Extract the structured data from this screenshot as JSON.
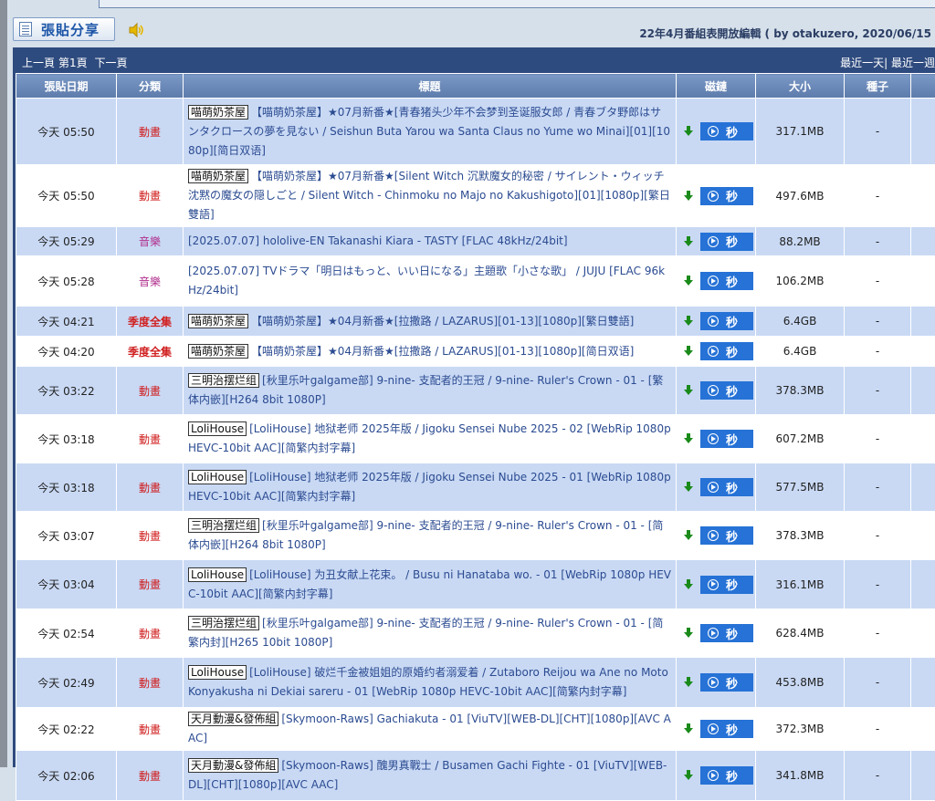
{
  "toolbar": {
    "post_label": "張貼分享"
  },
  "notice": {
    "text": "22年4月番組表開放編輯 ( by otakuzero, 2020/06/15"
  },
  "nav": {
    "prev": "上一頁",
    "page": "第1頁",
    "next": "下一頁",
    "recent_day": "最近一天",
    "sep": "|",
    "recent_more": "最近一週"
  },
  "columns": [
    "張貼日期",
    "分類",
    "標題",
    "磁鏈",
    "大小",
    "種子"
  ],
  "magnet_label": "秒",
  "rows": [
    {
      "date": "今天 05:50",
      "cat": "動畫",
      "cat_type": "anime",
      "tag": "喵萌奶茶屋",
      "title": "【喵萌奶茶屋】★07月新番★[青春猪头少年不会梦到圣诞服女郎 / 青春ブタ野郎はサンタクロースの夢を見ない / Seishun Buta Yarou wa Santa Claus no Yume wo Minai][01][1080p][简日双语]",
      "size": "317.1MB",
      "seed": "-"
    },
    {
      "date": "今天 05:50",
      "cat": "動畫",
      "cat_type": "anime",
      "tag": "喵萌奶茶屋",
      "title": "【喵萌奶茶屋】★07月新番★[Silent Witch 沉默魔女的秘密 / サイレント・ウィッチ 沈黙の魔女の隠しごと / Silent Witch - Chinmoku no Majo no Kakushigoto][01][1080p][繁日雙語]",
      "size": "497.6MB",
      "seed": "-"
    },
    {
      "date": "今天 05:29",
      "cat": "音樂",
      "cat_type": "music",
      "tag": "",
      "title": "[2025.07.07] hololive-EN Takanashi Kiara - TASTY [FLAC 48kHz/24bit]",
      "size": "88.2MB",
      "seed": "-"
    },
    {
      "date": "今天 05:28",
      "cat": "音樂",
      "cat_type": "music",
      "tag": "",
      "title": "[2025.07.07] TVドラマ「明日はもっと、いい日になる」主題歌「小さな歌」 / JUJU [FLAC 96kHz/24bit]",
      "size": "106.2MB",
      "seed": "-"
    },
    {
      "date": "今天 04:21",
      "cat": "季度全集",
      "cat_type": "season",
      "tag": "喵萌奶茶屋",
      "title": "【喵萌奶茶屋】★04月新番★[拉撒路 / LAZARUS][01-13][1080p][繁日雙語]",
      "size": "6.4GB",
      "seed": "-"
    },
    {
      "date": "今天 04:20",
      "cat": "季度全集",
      "cat_type": "season",
      "tag": "喵萌奶茶屋",
      "title": "【喵萌奶茶屋】★04月新番★[拉撒路 / LAZARUS][01-13][1080p][简日双语]",
      "size": "6.4GB",
      "seed": "-"
    },
    {
      "date": "今天 03:22",
      "cat": "動畫",
      "cat_type": "anime",
      "tag": "三明治摆烂组",
      "title": "[秋里乐叶galgame部] 9-nine- 支配者的王冠 / 9-nine- Ruler's Crown - 01 - [繁体内嵌][H264 8bit 1080P]",
      "size": "378.3MB",
      "seed": "-"
    },
    {
      "date": "今天 03:18",
      "cat": "動畫",
      "cat_type": "anime",
      "tag": "LoliHouse",
      "title": "[LoliHouse] 地狱老师 2025年版 / Jigoku Sensei Nube 2025 - 02 [WebRip 1080p HEVC-10bit AAC][简繁内封字幕]",
      "size": "607.2MB",
      "seed": "-"
    },
    {
      "date": "今天 03:18",
      "cat": "動畫",
      "cat_type": "anime",
      "tag": "LoliHouse",
      "title": "[LoliHouse] 地狱老师 2025年版 / Jigoku Sensei Nube 2025 - 01 [WebRip 1080p HEVC-10bit AAC][简繁内封字幕]",
      "size": "577.5MB",
      "seed": "-"
    },
    {
      "date": "今天 03:07",
      "cat": "動畫",
      "cat_type": "anime",
      "tag": "三明治摆烂组",
      "title": "[秋里乐叶galgame部] 9-nine- 支配者的王冠 / 9-nine- Ruler's Crown - 01 - [简体内嵌][H264 8bit 1080P]",
      "size": "378.3MB",
      "seed": "-"
    },
    {
      "date": "今天 03:04",
      "cat": "動畫",
      "cat_type": "anime",
      "tag": "LoliHouse",
      "title": "[LoliHouse] 为丑女献上花束。 / Busu ni Hanataba wo. - 01 [WebRip 1080p HEVC-10bit AAC][简繁内封字幕]",
      "size": "316.1MB",
      "seed": "-"
    },
    {
      "date": "今天 02:54",
      "cat": "動畫",
      "cat_type": "anime",
      "tag": "三明治摆烂组",
      "title": "[秋里乐叶galgame部] 9-nine- 支配者的王冠 / 9-nine- Ruler's Crown - 01 - [简繁内封][H265 10bit 1080P]",
      "size": "628.4MB",
      "seed": "-"
    },
    {
      "date": "今天 02:49",
      "cat": "動畫",
      "cat_type": "anime",
      "tag": "LoliHouse",
      "title": "[LoliHouse] 破烂千金被姐姐的原婚约者溺爱着 / Zutaboro Reijou wa Ane no Moto Konyakusha ni Dekiai sareru - 01 [WebRip 1080p HEVC-10bit AAC][简繁内封字幕]",
      "size": "453.8MB",
      "seed": "-"
    },
    {
      "date": "今天 02:22",
      "cat": "動畫",
      "cat_type": "anime",
      "tag": "天月動漫&發佈組",
      "title": "[Skymoon-Raws] Gachiakuta - 01 [ViuTV][WEB-DL][CHT][1080p][AVC AAC]",
      "size": "372.3MB",
      "seed": "-"
    },
    {
      "date": "今天 02:06",
      "cat": "動畫",
      "cat_type": "anime",
      "tag": "天月動漫&發佈組",
      "title": "[Skymoon-Raws] 醜男真戰士 / Busamen Gachi Fighte - 01 [ViuTV][WEB-DL][CHT][1080p][AVC AAC]",
      "size": "341.8MB",
      "seed": "-"
    }
  ]
}
